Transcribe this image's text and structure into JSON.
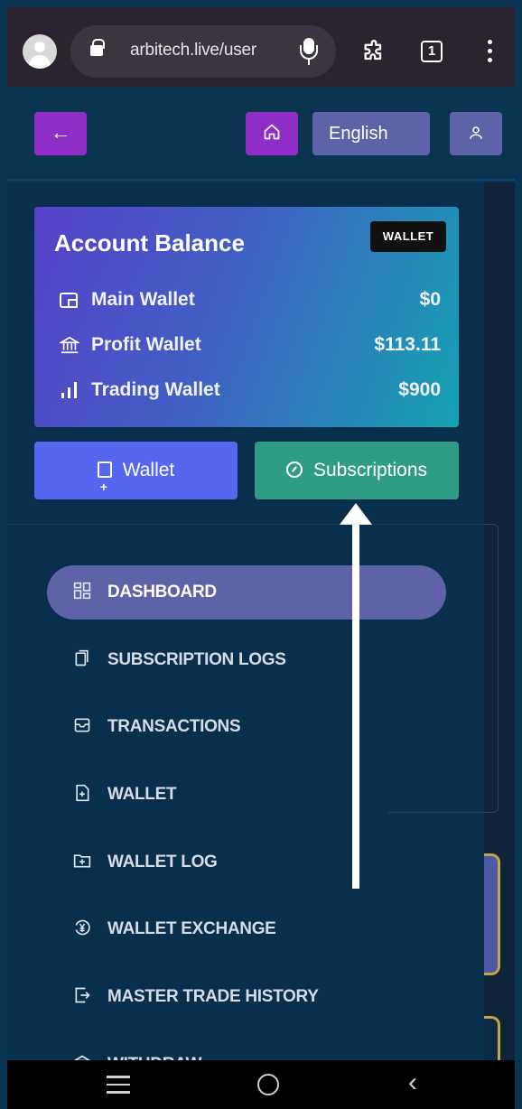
{
  "browser": {
    "url": "arbitech.live/user",
    "tab_count": "1",
    "icons": [
      "profile-icon",
      "lock-icon",
      "mic-icon",
      "extensions-icon",
      "tabs-icon",
      "more-icon"
    ]
  },
  "header": {
    "back_icon": "←",
    "home_icon": "⌂",
    "language": "English",
    "user_icon": "user-icon"
  },
  "balance_card": {
    "title": "Account Balance",
    "tag": "WALLET",
    "rows": [
      {
        "label": "Main Wallet",
        "value": "$0",
        "icon": "wallet-icon"
      },
      {
        "label": "Profit Wallet",
        "value": "$113.11",
        "icon": "bank-icon"
      },
      {
        "label": "Trading Wallet",
        "value": "$900",
        "icon": "bars-icon"
      }
    ]
  },
  "actions": {
    "wallet_label": "Wallet",
    "subscriptions_label": "Subscriptions"
  },
  "menu": {
    "items": [
      {
        "label": "DASHBOARD",
        "icon": "dashboard-icon",
        "active": true
      },
      {
        "label": "SUBSCRIPTION LOGS",
        "icon": "copy-icon"
      },
      {
        "label": "TRANSACTIONS",
        "icon": "inbox-icon"
      },
      {
        "label": "WALLET",
        "icon": "file-plus-icon"
      },
      {
        "label": "WALLET LOG",
        "icon": "folder-plus-icon"
      },
      {
        "label": "WALLET EXCHANGE",
        "icon": "yen-circle-icon"
      },
      {
        "label": "MASTER TRADE HISTORY",
        "icon": "export-icon"
      },
      {
        "label": "WITHDRAW",
        "icon": "bank-icon"
      }
    ]
  },
  "colors": {
    "accent_purple": "#8e2ec6",
    "accent_slate": "#5e62a6",
    "wallet_button": "#5566ef",
    "subscriptions_button": "#2f9d85"
  }
}
